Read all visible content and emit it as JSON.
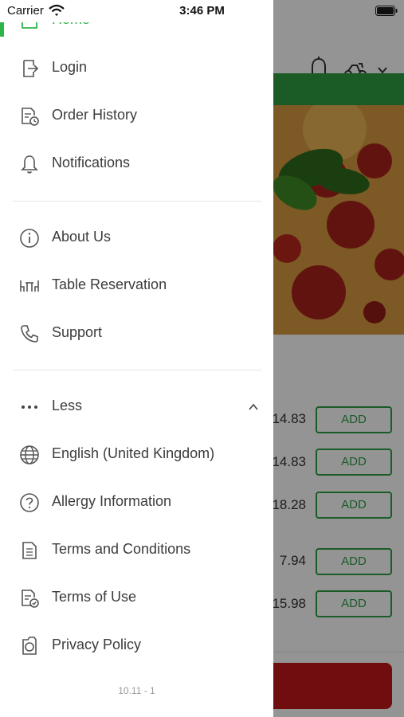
{
  "status_bar": {
    "carrier": "Carrier",
    "time": "3:46 PM"
  },
  "menu": {
    "home": "Home",
    "login": "Login",
    "order_history": "Order History",
    "notifications": "Notifications",
    "about_us": "About Us",
    "table_reservation": "Table Reservation",
    "support": "Support",
    "less": "Less",
    "language": "English (United Kingdom)",
    "allergy_information": "Allergy Information",
    "terms_and_conditions": "Terms and Conditions",
    "terms_of_use": "Terms of Use",
    "privacy_policy": "Privacy Policy"
  },
  "version": "10.11 - 1",
  "background": {
    "items": [
      {
        "price": "14.83",
        "add_label": "ADD"
      },
      {
        "price": "14.83",
        "add_label": "ADD"
      },
      {
        "price": "18.28",
        "add_label": "ADD"
      },
      {
        "price": "7.94",
        "add_label": "ADD"
      },
      {
        "price": "15.98",
        "add_label": "ADD"
      }
    ]
  },
  "colors": {
    "accent_green": "#2eb24a",
    "brand_red": "#c0181a",
    "text": "#3c3c3c"
  }
}
